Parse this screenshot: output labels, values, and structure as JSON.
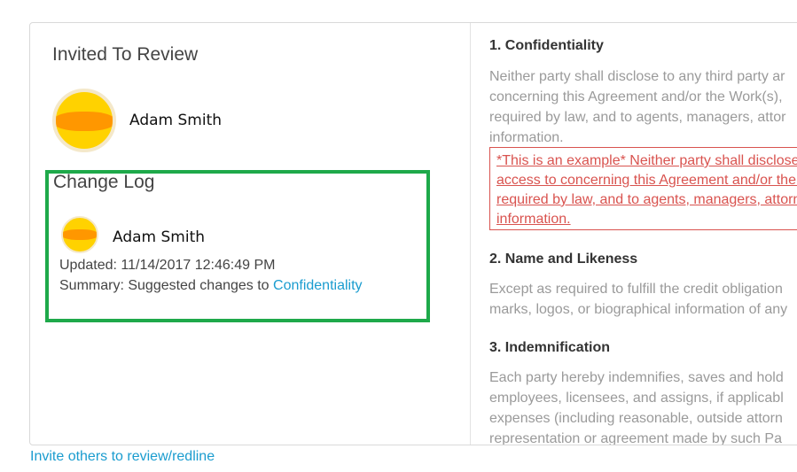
{
  "review": {
    "title": "Invited To Review",
    "reviewer_name": "Adam Smith"
  },
  "change_log": {
    "title": "Change Log",
    "user_name": "Adam Smith",
    "updated": "Updated: 11/14/2017 12:46:49 PM",
    "summary_prefix": "Summary: Suggested changes to ",
    "summary_link": "Confidentiality"
  },
  "document": {
    "sections": [
      {
        "heading": "1. Confidentiality",
        "lines": [
          "Neither party shall disclose to any third party ar",
          "concerning this Agreement and/or the Work(s),",
          "required by law, and to agents, managers, attor",
          "information."
        ],
        "example_lines": [
          "*This is an example* Neither party shall disclose t",
          "access to concerning this Agreement and/or the W",
          "required by law, and to agents, managers, attorne",
          "information."
        ]
      },
      {
        "heading": "2. Name and Likeness",
        "lines": [
          "Except as required to fulfill the credit obligation",
          "marks, logos, or biographical information of any"
        ]
      },
      {
        "heading": "3. Indemnification",
        "lines": [
          "Each party hereby indemnifies, saves and hold",
          "employees, licensees, and assigns, if applicabl",
          "expenses (including reasonable, outside attorn",
          "representation or agreement made by such Pa"
        ]
      }
    ]
  },
  "footer": {
    "invite_link": "Invite others to review/redline"
  },
  "colors": {
    "link": "#1a9ccf",
    "highlight_border": "#1ea94a",
    "suggestion": "#d9534f"
  }
}
